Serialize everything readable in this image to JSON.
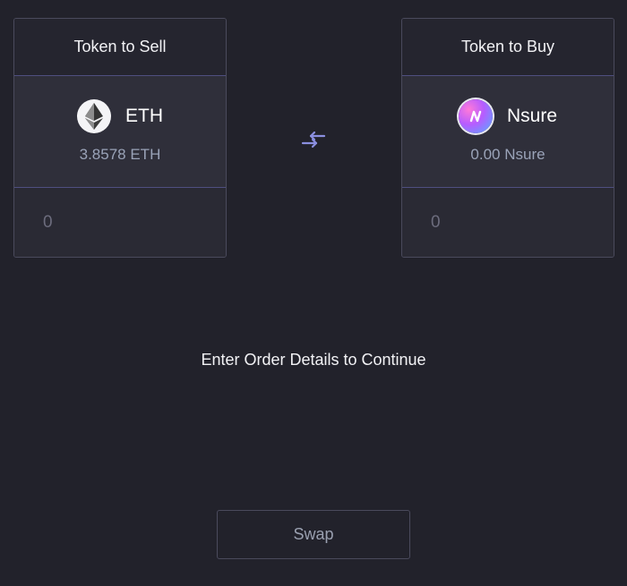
{
  "sell": {
    "header": "Token to Sell",
    "token_symbol": "ETH",
    "token_icon": "ethereum-icon",
    "balance": "3.8578 ETH",
    "amount_placeholder": "0"
  },
  "buy": {
    "header": "Token to Buy",
    "token_symbol": "Nsure",
    "token_icon": "nsure-icon",
    "balance": "0.00 Nsure",
    "amount_placeholder": "0"
  },
  "swap_direction_icon": "swap-arrows-icon",
  "status_message": "Enter Order Details to Continue",
  "swap_button_label": "Swap",
  "colors": {
    "background": "#22222b",
    "card": "#2f2f3a",
    "divider": "#4f4f80",
    "accent": "#8b8fe0",
    "muted_text": "#9aa3b8"
  }
}
